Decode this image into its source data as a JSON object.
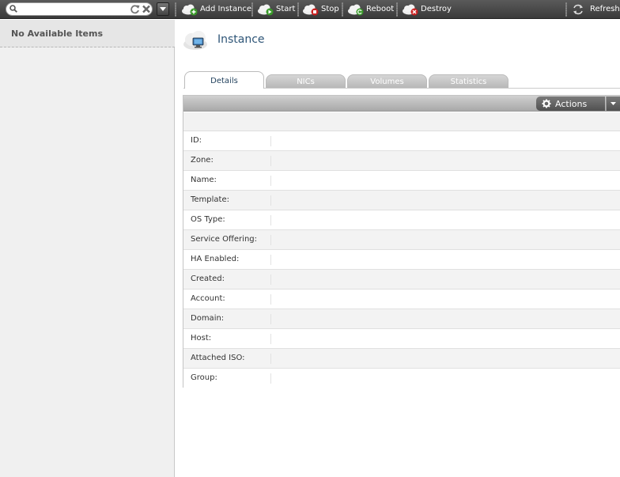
{
  "search": {
    "placeholder": ""
  },
  "toolbar": {
    "add_instance": "Add Instance",
    "start": "Start",
    "stop": "Stop",
    "reboot": "Reboot",
    "destroy": "Destroy",
    "refresh": "Refresh"
  },
  "left_panel": {
    "empty_text": "No Available Items"
  },
  "main": {
    "title": "Instance",
    "tabs": [
      {
        "label": "Details"
      },
      {
        "label": "NICs"
      },
      {
        "label": "Volumes"
      },
      {
        "label": "Statistics"
      }
    ],
    "actions_label": "Actions",
    "fields": [
      {
        "label": "ID:"
      },
      {
        "label": "Zone:"
      },
      {
        "label": "Name:"
      },
      {
        "label": "Template:"
      },
      {
        "label": "OS Type:"
      },
      {
        "label": "Service Offering:"
      },
      {
        "label": "HA Enabled:"
      },
      {
        "label": "Created:"
      },
      {
        "label": "Account:"
      },
      {
        "label": "Domain:"
      },
      {
        "label": "Host:"
      },
      {
        "label": "Attached ISO:"
      },
      {
        "label": "Group:"
      }
    ]
  },
  "colors": {
    "toolbar_bg": "#4a4a4a",
    "title_blue": "#2e5577",
    "start_green": "#3a9a2a",
    "stop_red": "#cc2222"
  }
}
